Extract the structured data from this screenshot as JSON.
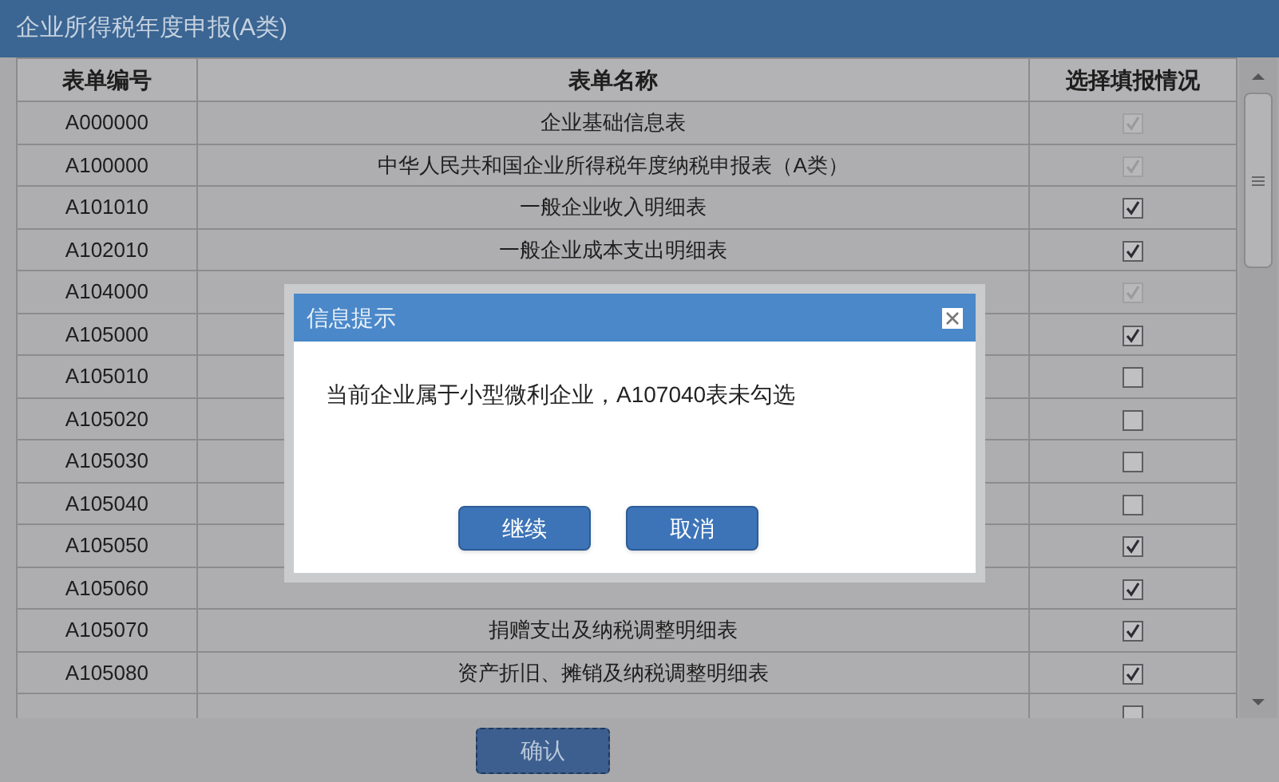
{
  "window": {
    "title": "企业所得税年度申报(A类)"
  },
  "table": {
    "columns": [
      "表单编号",
      "表单名称",
      "选择填报情况"
    ],
    "rows": [
      {
        "code": "A000000",
        "name": "企业基础信息表",
        "checked": true,
        "disabled": true
      },
      {
        "code": "A100000",
        "name": "中华人民共和国企业所得税年度纳税申报表（A类）",
        "checked": true,
        "disabled": true
      },
      {
        "code": "A101010",
        "name": "一般企业收入明细表",
        "checked": true,
        "disabled": false
      },
      {
        "code": "A102010",
        "name": "一般企业成本支出明细表",
        "checked": true,
        "disabled": false
      },
      {
        "code": "A104000",
        "checked": true,
        "disabled": true
      },
      {
        "code": "A105000",
        "checked": true,
        "disabled": false
      },
      {
        "code": "A105010",
        "checked": false,
        "disabled": false
      },
      {
        "code": "A105020",
        "checked": false,
        "disabled": false
      },
      {
        "code": "A105030",
        "checked": false,
        "disabled": false
      },
      {
        "code": "A105040",
        "checked": false,
        "disabled": false
      },
      {
        "code": "A105050",
        "checked": true,
        "disabled": false
      },
      {
        "code": "A105060",
        "checked": true,
        "disabled": false
      },
      {
        "code": "A105070",
        "name": "捐赠支出及纳税调整明细表",
        "checked": true,
        "disabled": false
      },
      {
        "code": "A105080",
        "name": "资产折旧、摊销及纳税调整明细表",
        "checked": true,
        "disabled": false
      },
      {
        "checked": false,
        "disabled": false
      }
    ]
  },
  "confirm_button": "确认",
  "dialog": {
    "title": "信息提示",
    "message": "当前企业属于小型微利企业，A107040表未勾选",
    "buttons": [
      "继续",
      "取消"
    ]
  }
}
